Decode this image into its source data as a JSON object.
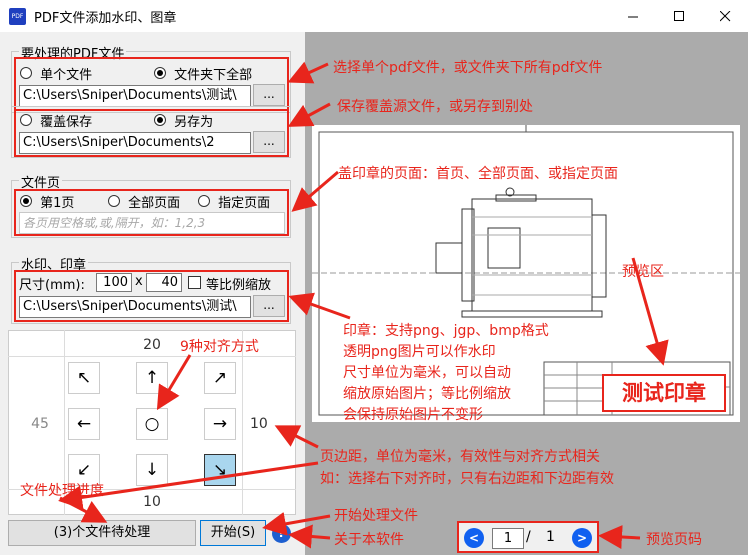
{
  "window": {
    "title": "PDF文件添加水印、图章",
    "icon_label": "PDF"
  },
  "source_group": {
    "legend": "要处理的PDF文件",
    "options": [
      "单个文件",
      "文件夹下全部"
    ],
    "selected": 1,
    "path": "C:\\Users\\Sniper\\Documents\\测试\\",
    "browse": "..."
  },
  "save_group": {
    "options": [
      "覆盖保存",
      "另存为"
    ],
    "selected": 1,
    "path": "C:\\Users\\Sniper\\Documents\\2",
    "browse": "..."
  },
  "pages_group": {
    "legend": "文件页",
    "options": [
      "第1页",
      "全部页面",
      "指定页面"
    ],
    "selected": 0,
    "placeholder": "各页用空格或,或,隔开，如：1,2,3"
  },
  "stamp_group": {
    "legend": "水印、印章",
    "size_label": "尺寸(mm):",
    "width": "100",
    "times": "x",
    "height": "40",
    "keep_ratio_label": "等比例缩放",
    "path": "C:\\Users\\Sniper\\Documents\\测试\\",
    "browse": "..."
  },
  "alignment": {
    "top_margin": "20",
    "left_margin": "45",
    "right_margin": "10",
    "bottom_margin": "10",
    "arrows": [
      "↖",
      "↑",
      "↗",
      "←",
      "○",
      "→",
      "↙",
      "↓",
      "↘"
    ],
    "selected": 8
  },
  "footer": {
    "status_button": "(3)个文件待处理",
    "start_button": "开始(S)",
    "help_button": "?"
  },
  "preview": {
    "stamp_text": "测试印章",
    "page_current": "1",
    "page_sep": "/",
    "page_total": "1",
    "prev": "<",
    "next": ">"
  },
  "annotations": {
    "a1": "选择单个pdf文件，或文件夹下所有pdf文件",
    "a2": "保存覆盖源文件，或另存到别处",
    "a3": "盖印章的页面：首页、全部页面、或指定页面",
    "a4": "预览区",
    "a5": [
      "印章：支持png、jgp、bmp格式",
      "透明png图片可以作水印",
      "尺寸单位为毫米，可以自动",
      "缩放原始图片；等比例缩放",
      "会保持原始图片不变形"
    ],
    "a6": "9种对齐方式",
    "a7": [
      "页边距，单位为毫米，有效性与对齐方式相关",
      "如：选择右下对齐时，只有右边距和下边距有效"
    ],
    "a8": "文件处理进度",
    "a9": "开始处理文件",
    "a10": "关于本软件",
    "a11": "预览页码"
  },
  "colors": {
    "annotation": "#e8251c",
    "selected_cell": "#a9d6ee",
    "nav_button": "#1060f0",
    "preview_bg": "#ababab"
  }
}
